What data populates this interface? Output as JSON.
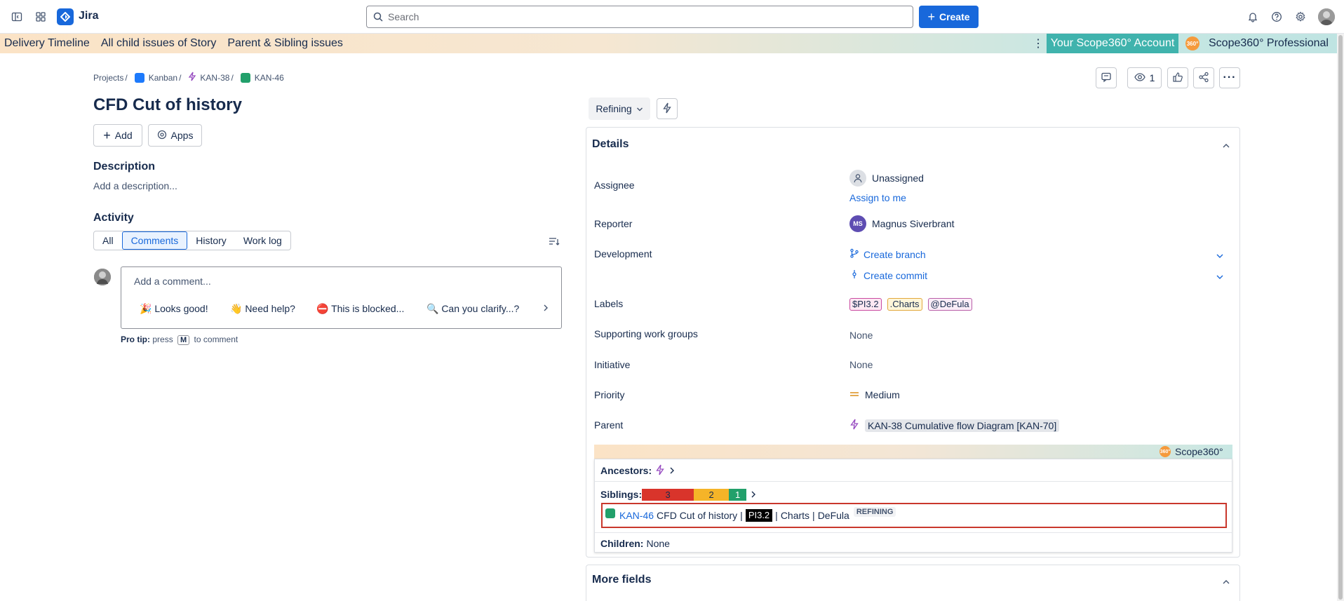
{
  "app": {
    "name": "Jira"
  },
  "search": {
    "placeholder": "Search"
  },
  "create": {
    "label": "Create"
  },
  "banner": {
    "links": [
      "Delivery Timeline",
      "All child issues of Story",
      "Parent & Sibling issues"
    ],
    "account": "Your Scope360° Account",
    "logo": "360°",
    "product": "Scope360° Professional"
  },
  "breadcrumb": {
    "projects": "Projects",
    "project": "Kanban",
    "parent": "KAN-38",
    "issue": "KAN-46"
  },
  "issue": {
    "title": "CFD Cut of history"
  },
  "actions": {
    "add": "Add",
    "apps": "Apps"
  },
  "description": {
    "heading": "Description",
    "placeholder": "Add a description..."
  },
  "activity": {
    "heading": "Activity",
    "tabs": [
      "All",
      "Comments",
      "History",
      "Work log"
    ],
    "active_tab": "Comments"
  },
  "comment": {
    "placeholder": "Add a comment...",
    "quick_replies": [
      "🎉 Looks good!",
      "👋 Need help?",
      "⛔ This is blocked...",
      "🔍 Can you clarify...?"
    ],
    "protip_label": "Pro tip:",
    "protip_pre": "press",
    "protip_key": "M",
    "protip_post": "to comment"
  },
  "toolbar": {
    "watchers": "1"
  },
  "status": {
    "label": "Refining"
  },
  "details": {
    "heading": "Details",
    "assignee": {
      "label": "Assignee",
      "value": "Unassigned",
      "assign_link": "Assign to me"
    },
    "reporter": {
      "label": "Reporter",
      "initials": "MS",
      "value": "Magnus Siverbrant"
    },
    "development": {
      "label": "Development",
      "create_branch": "Create branch",
      "create_commit": "Create commit"
    },
    "labels": {
      "label": "Labels",
      "values": [
        "$PI3.2",
        ".Charts",
        "@DeFula"
      ]
    },
    "supporting": {
      "label": "Supporting work groups",
      "value": "None"
    },
    "initiative": {
      "label": "Initiative",
      "value": "None"
    },
    "priority": {
      "label": "Priority",
      "value": "Medium"
    },
    "parent": {
      "label": "Parent",
      "value": "KAN-38 Cumulative flow Diagram [KAN-70]"
    }
  },
  "scope360": {
    "bar_logo": "360°",
    "bar_label": "Scope360°",
    "ancestors_label": "Ancestors:",
    "siblings_label": "Siblings:",
    "siblings": [
      {
        "count": "3",
        "color": "#d9342b"
      },
      {
        "count": "2",
        "color": "#f5b428"
      },
      {
        "count": "1",
        "color": "#22a06b"
      }
    ],
    "current": {
      "key": "KAN-46",
      "summary": "CFD Cut of history",
      "sep": "|",
      "pi": "PI3.2",
      "label1": "Charts",
      "label2": "DeFula",
      "status": "REFINING"
    },
    "children_label": "Children:",
    "children_value": "None"
  },
  "more_fields": {
    "heading": "More fields"
  },
  "colors": {
    "brand": "#1868db",
    "accent_teal": "#40b3ad",
    "scope_orange": "#f59a3c"
  }
}
